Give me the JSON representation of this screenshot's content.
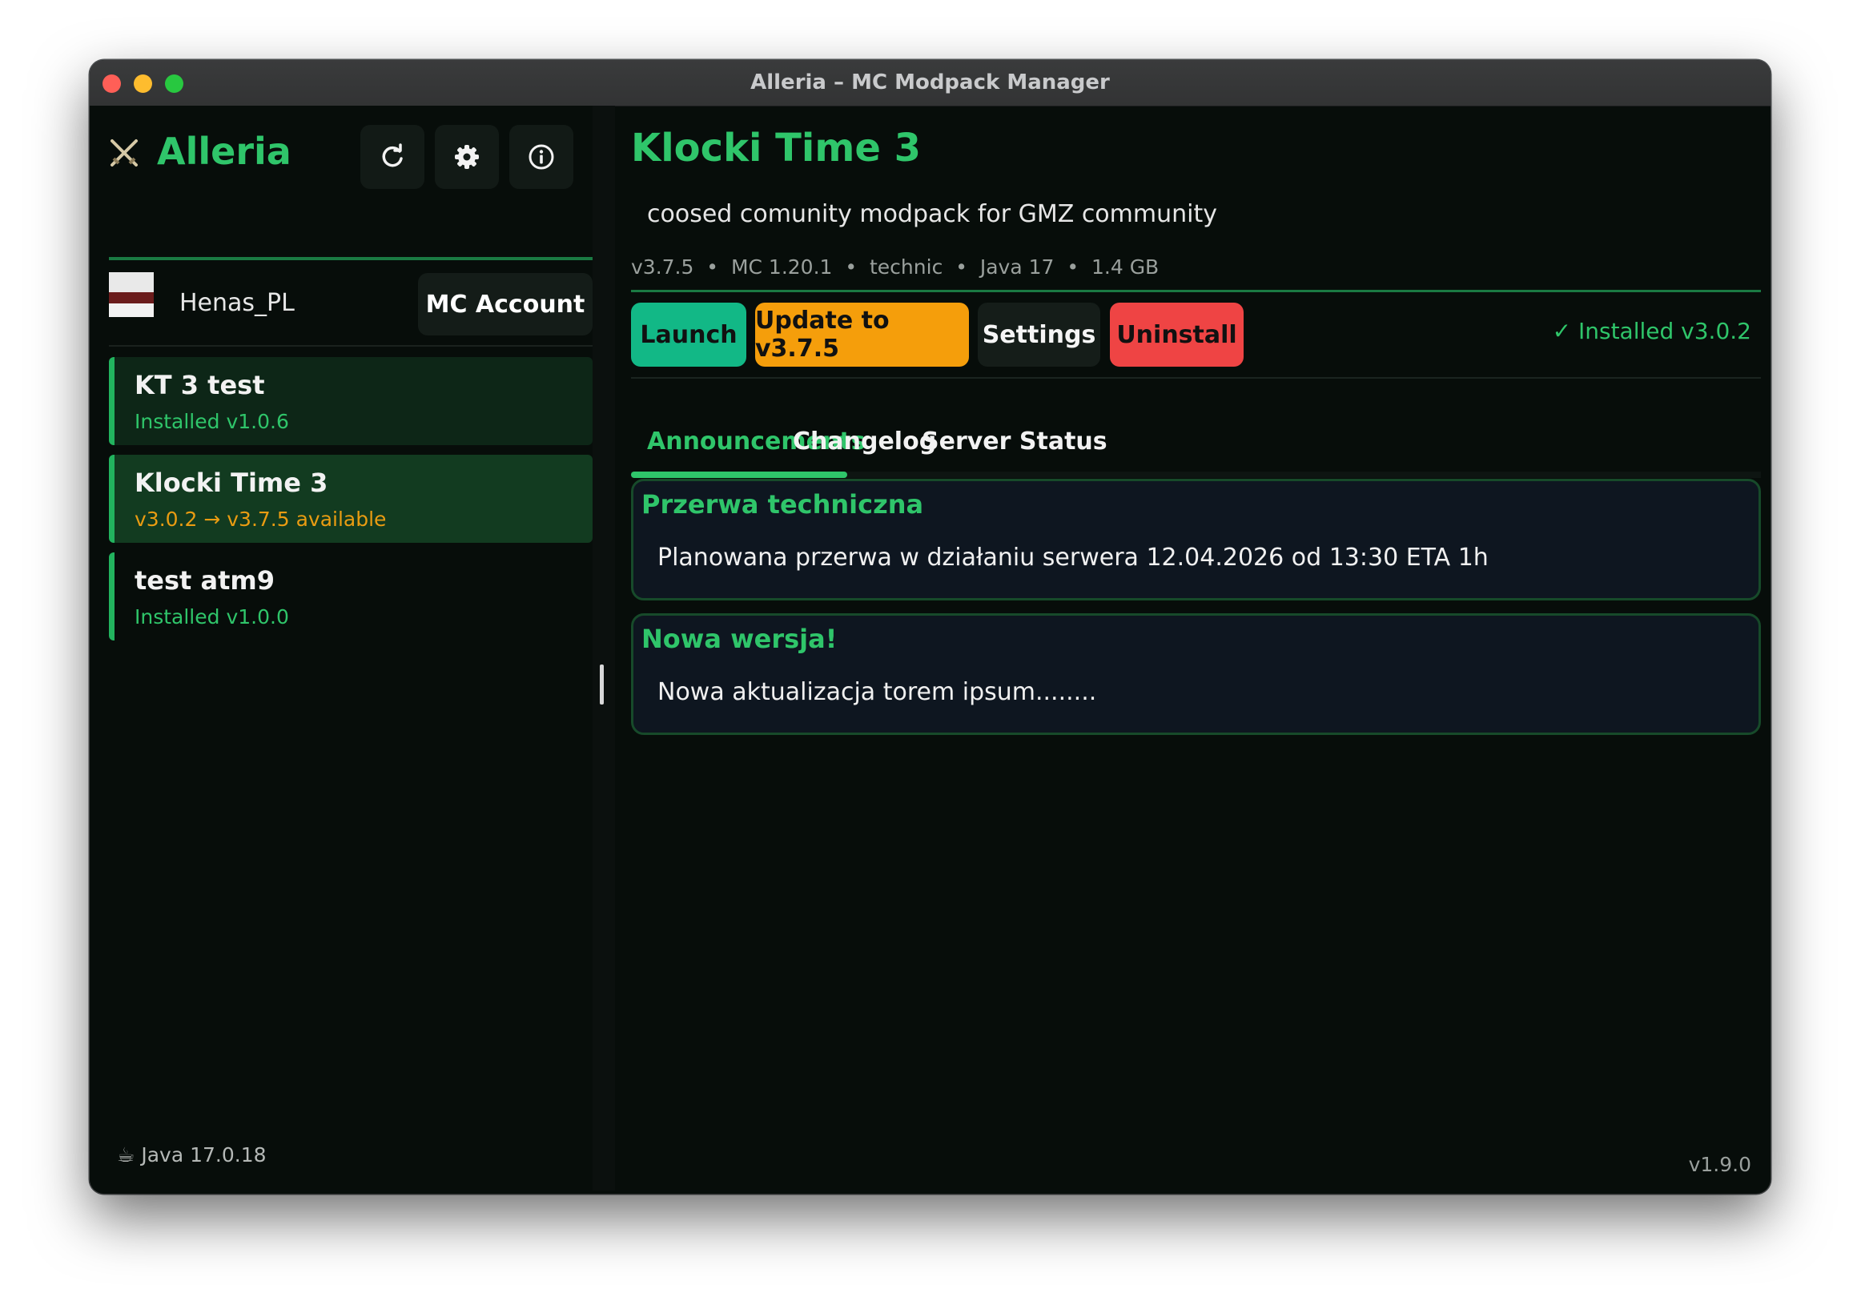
{
  "window": {
    "title": "Alleria – MC Modpack Manager"
  },
  "sidebar": {
    "app_name": "Alleria",
    "toolbar_icons": [
      "refresh-icon",
      "gear-icon",
      "info-icon"
    ],
    "user": {
      "name": "Henas_PL",
      "account_button": "MC Account"
    },
    "packs": [
      {
        "name": "KT 3 test",
        "status": "Installed v1.0.6",
        "status_type": "installed",
        "selected": false
      },
      {
        "name": "Klocki Time 3",
        "status": "v3.0.2 → v3.7.5 available",
        "status_type": "update",
        "selected": true
      },
      {
        "name": "test atm9",
        "status": "Installed v1.0.0",
        "status_type": "installed",
        "selected": false
      }
    ],
    "java": "☕ Java 17.0.18"
  },
  "main": {
    "title": "Klocki Time 3",
    "description": "coosed comunity modpack for GMZ community",
    "meta": [
      "v3.7.5",
      "MC 1.20.1",
      "technic",
      "Java 17",
      "1.4 GB"
    ],
    "buttons": {
      "launch": "Launch",
      "update": "Update to v3.7.5",
      "settings": "Settings",
      "uninstall": "Uninstall"
    },
    "installed": "✓ Installed v3.0.2",
    "tabs": [
      "Announcements",
      "Changelog",
      "Server Status"
    ],
    "active_tab": "Announcements",
    "announcements": [
      {
        "title": "Przerwa techniczna",
        "body": "Planowana przerwa w działaniu serwera 12.04.2026 od 13:30 ETA 1h"
      },
      {
        "title": "Nowa wersja!",
        "body": "Nowa aktualizacja torem ipsum........"
      }
    ]
  },
  "app_version": "v1.9.0",
  "colors": {
    "accent": "#2fc56a",
    "background": "#070d0a",
    "launch": "#12b886",
    "update": "#f59e0b",
    "uninstall": "#ef4444",
    "card_bg": "#0e1620"
  }
}
